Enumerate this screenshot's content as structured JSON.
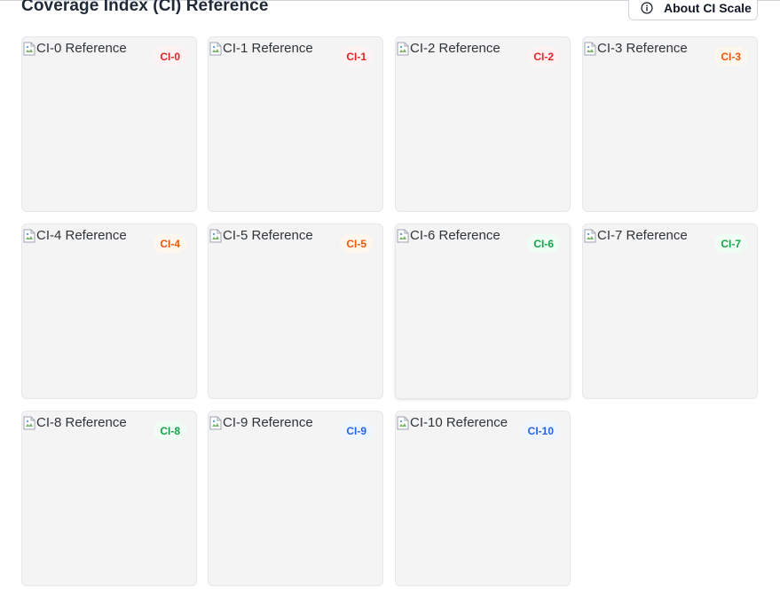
{
  "header": {
    "title": "Coverage Index (CI) Reference",
    "about_button": {
      "label": "About CI Scale",
      "icon": "info-circle-icon"
    }
  },
  "cards": [
    {
      "alt": "CI-0 Reference",
      "badge": "CI-0",
      "tone": "red"
    },
    {
      "alt": "CI-1 Reference",
      "badge": "CI-1",
      "tone": "red"
    },
    {
      "alt": "CI-2 Reference",
      "badge": "CI-2",
      "tone": "red"
    },
    {
      "alt": "CI-3 Reference",
      "badge": "CI-3",
      "tone": "orange"
    },
    {
      "alt": "CI-4 Reference",
      "badge": "CI-4",
      "tone": "orange"
    },
    {
      "alt": "CI-5 Reference",
      "badge": "CI-5",
      "tone": "orange"
    },
    {
      "alt": "CI-6 Reference",
      "badge": "CI-6",
      "tone": "green"
    },
    {
      "alt": "CI-7 Reference",
      "badge": "CI-7",
      "tone": "green"
    },
    {
      "alt": "CI-8 Reference",
      "badge": "CI-8",
      "tone": "green"
    },
    {
      "alt": "CI-9 Reference",
      "badge": "CI-9",
      "tone": "blue"
    },
    {
      "alt": "CI-10 Reference",
      "badge": "CI-10",
      "tone": "blue"
    }
  ],
  "badge_colors": {
    "red": {
      "text": "#dc2626",
      "bg": "#fef2f2"
    },
    "orange": {
      "text": "#ea580c",
      "bg": "#fff7ed"
    },
    "green": {
      "text": "#16a34a",
      "bg": "#f0fdf4"
    },
    "blue": {
      "text": "#2563eb",
      "bg": "#eff6ff"
    }
  }
}
